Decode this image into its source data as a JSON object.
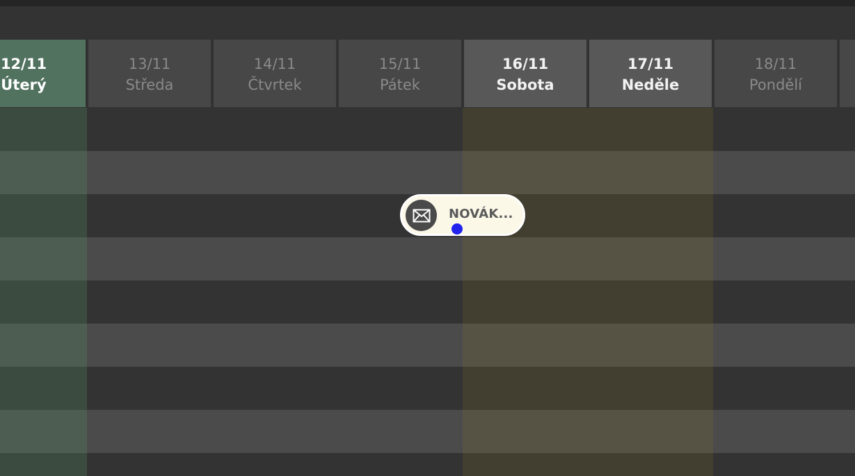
{
  "days": [
    {
      "date": "12/11",
      "name": "Úterý"
    },
    {
      "date": "13/11",
      "name": "Středa"
    },
    {
      "date": "14/11",
      "name": "Čtvrtek"
    },
    {
      "date": "15/11",
      "name": "Pátek"
    },
    {
      "date": "16/11",
      "name": "Sobota"
    },
    {
      "date": "17/11",
      "name": "Neděle"
    },
    {
      "date": "18/11",
      "name": "Pondělí"
    }
  ],
  "event": {
    "label": "NOVÁK...",
    "icon": "mail-icon"
  },
  "colors": {
    "today_header": "#527260",
    "weekend_highlight": "#fbf8e8",
    "status_dot": "#2323ee"
  }
}
